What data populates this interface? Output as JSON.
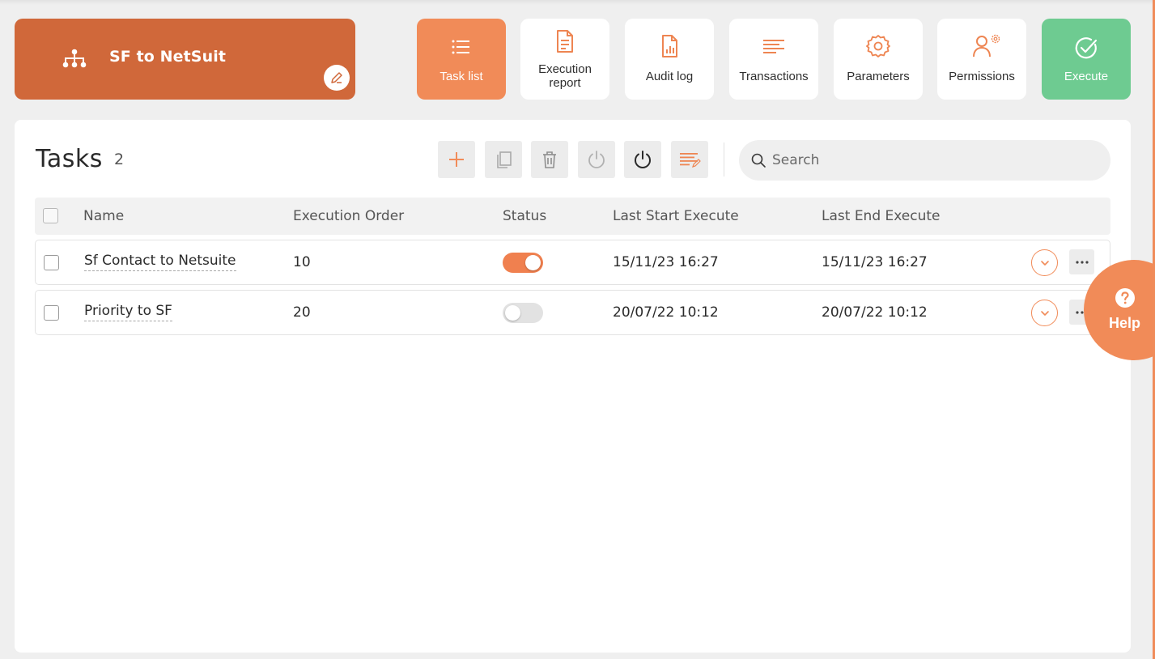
{
  "project": {
    "title": "SF to NetSuit",
    "icon": "sitemap-icon",
    "edit_icon": "pencil-icon"
  },
  "nav": [
    {
      "label": "Task list",
      "icon": "list-icon",
      "active": true
    },
    {
      "label": "Execution report",
      "icon": "document-icon"
    },
    {
      "label": "Audit log",
      "icon": "report-chart-icon"
    },
    {
      "label": "Transactions",
      "icon": "lines-icon"
    },
    {
      "label": "Parameters",
      "icon": "gear-icon"
    },
    {
      "label": "Permissions",
      "icon": "user-gear-icon"
    },
    {
      "label": "Execute",
      "icon": "check-circle-icon"
    }
  ],
  "tasks": {
    "heading": "Tasks",
    "count": "2",
    "search_placeholder": "Search",
    "tools": [
      "plus-icon",
      "copy-icon",
      "trash-icon",
      "power-disabled-icon",
      "power-icon",
      "edit-list-icon"
    ],
    "columns": [
      "Name",
      "Execution Order",
      "Status",
      "Last Start Execute",
      "Last End Execute"
    ],
    "rows": [
      {
        "name": "Sf Contact to Netsuite",
        "order": "10",
        "status_on": true,
        "last_start": "15/11/23 16:27",
        "last_end": "15/11/23 16:27"
      },
      {
        "name": "Priority to SF",
        "order": "20",
        "status_on": false,
        "last_start": "20/07/22 10:12",
        "last_end": "20/07/22 10:12"
      }
    ]
  },
  "help": {
    "label": "Help",
    "icon": "question-circle-icon"
  },
  "colors": {
    "brand": "#d0683a",
    "accent": "#f18b58",
    "execute": "#6ecb91",
    "background": "#efefef"
  }
}
